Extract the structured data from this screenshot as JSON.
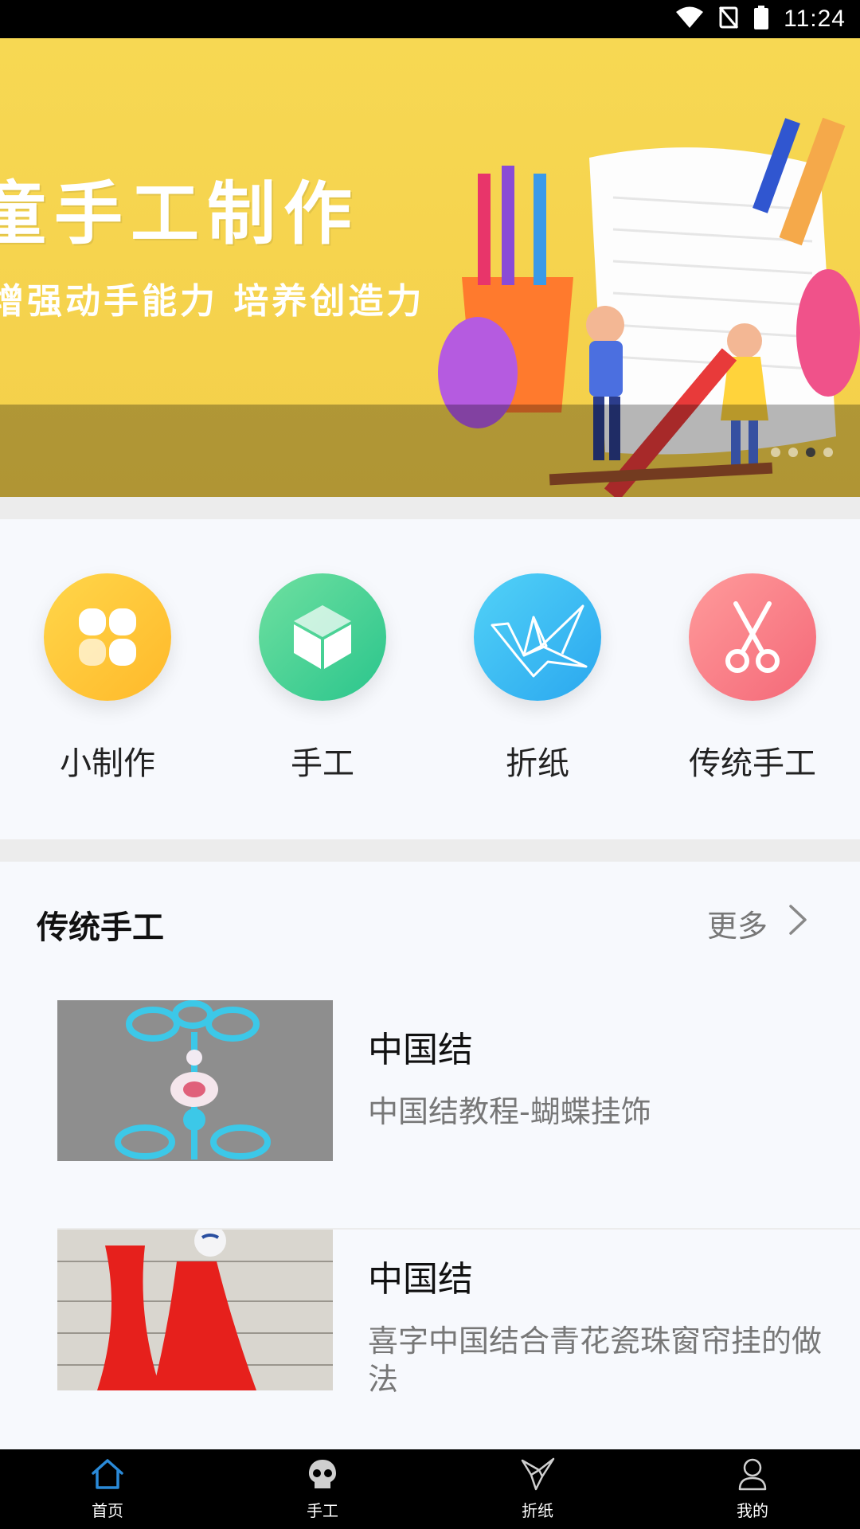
{
  "status_bar": {
    "time": "11:24"
  },
  "banner": {
    "title": "童手工制作",
    "subtitle": "增强动手能力 培养创造力",
    "page_indicator": {
      "count": 4,
      "active_index": 2
    }
  },
  "categories": [
    {
      "label": "小制作",
      "icon": "four-petal-icon",
      "color_from": "#ffd64a",
      "color_to": "#ffb92a"
    },
    {
      "label": "手工",
      "icon": "cube-icon",
      "color_from": "#6fe0a0",
      "color_to": "#2ac58c"
    },
    {
      "label": "折纸",
      "icon": "paper-crane-icon",
      "color_from": "#52d2f7",
      "color_to": "#2aa7ef"
    },
    {
      "label": "传统手工",
      "icon": "scissors-icon",
      "color_from": "#ff9b9b",
      "color_to": "#f46878"
    }
  ],
  "section": {
    "title": "传统手工",
    "more_label": "更多",
    "items": [
      {
        "title": "中国结",
        "description": "中国结教程-蝴蝶挂饰"
      },
      {
        "title": "中国结",
        "description": "喜字中国结合青花瓷珠窗帘挂的做法"
      }
    ]
  },
  "bottom_nav": [
    {
      "label": "首页",
      "icon": "home-icon",
      "active": true
    },
    {
      "label": "手工",
      "icon": "skull-icon",
      "active": false
    },
    {
      "label": "折纸",
      "icon": "origami-icon",
      "active": false
    },
    {
      "label": "我的",
      "icon": "user-icon",
      "active": false
    }
  ],
  "colors": {
    "accent": "#2a8ad8",
    "nav_bg": "#000000",
    "page_bg": "#f7f9fd"
  }
}
